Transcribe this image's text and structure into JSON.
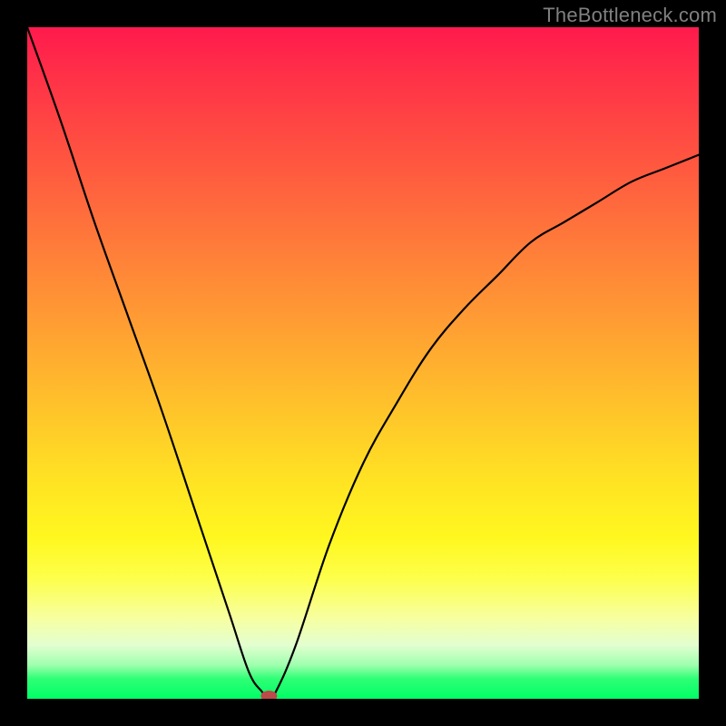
{
  "watermark": "TheBottleneck.com",
  "colors": {
    "frame": "#000000",
    "curve": "#000000",
    "marker": "#bb4a4a",
    "gradient_top": "#ff1a4d",
    "gradient_bottom": "#00ff66",
    "watermark": "#808080"
  },
  "chart_data": {
    "type": "line",
    "title": "",
    "xlabel": "",
    "ylabel": "",
    "xlim": [
      0,
      100
    ],
    "ylim": [
      0,
      100
    ],
    "grid": false,
    "legend": false,
    "series": [
      {
        "name": "bottleneck-curve",
        "x": [
          0,
          5,
          10,
          15,
          20,
          25,
          30,
          33,
          35,
          36,
          37,
          40,
          45,
          50,
          55,
          60,
          65,
          70,
          75,
          80,
          85,
          90,
          95,
          100
        ],
        "values": [
          100,
          86,
          71,
          57,
          43,
          28,
          13,
          4,
          1,
          0,
          1,
          8,
          23,
          35,
          44,
          52,
          58,
          63,
          68,
          71,
          74,
          77,
          79,
          81
        ]
      }
    ],
    "annotations": [
      {
        "name": "optimal-marker",
        "x": 36,
        "y": 0
      }
    ],
    "background_gradient": {
      "direction": "vertical",
      "stops": [
        {
          "pos": 0.0,
          "color": "#ff1a4d"
        },
        {
          "pos": 0.5,
          "color": "#ffc12b"
        },
        {
          "pos": 0.8,
          "color": "#fff71f"
        },
        {
          "pos": 1.0,
          "color": "#00ff66"
        }
      ]
    }
  }
}
